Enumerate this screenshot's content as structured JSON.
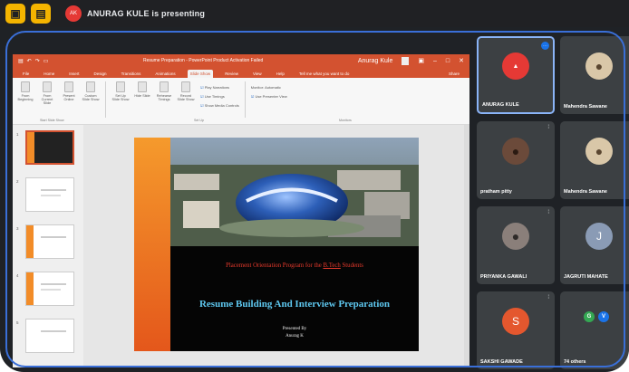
{
  "meet": {
    "presenting_text": "ANURAG KULE is presenting",
    "presenter_initial": "AK"
  },
  "powerpoint": {
    "window_title": "Resume Preparation - PowerPoint Product Activation Failed",
    "user": "Anurag Kule",
    "tabs": [
      "File",
      "Home",
      "Insert",
      "Design",
      "Transitions",
      "Animations",
      "Slide Show",
      "Review",
      "View",
      "Help",
      "Tell me what you want to do"
    ],
    "active_tab": "Slide Show",
    "share_label": "Share",
    "ribbon": {
      "buttons": [
        {
          "label": "From Beginning"
        },
        {
          "label": "From Current Slide"
        },
        {
          "label": "Present Online"
        },
        {
          "label": "Custom Slide Show"
        },
        {
          "label": "Set Up Slide Show"
        },
        {
          "label": "Hide Slide"
        },
        {
          "label": "Rehearse Timings"
        },
        {
          "label": "Record Slide Show"
        }
      ],
      "checks": [
        {
          "label": "Play Narrations",
          "on": true
        },
        {
          "label": "Use Timings",
          "on": true
        },
        {
          "label": "Show Media Controls",
          "on": true
        }
      ],
      "monitor_label": "Monitor: Automatic",
      "presenter_view_label": "Use Presenter View",
      "group_start": "Start Slide Show",
      "group_setup": "Set Up",
      "group_monitors": "Monitors"
    },
    "thumbnails": [
      "1",
      "2",
      "3",
      "4",
      "5"
    ],
    "slide": {
      "heading_prefix": "Placement Orientation Program for the ",
      "heading_link": "B.Tech",
      "heading_suffix": " Students",
      "title": "Resume Building And Interview Preparation",
      "presented_by": "Presented By",
      "presenter_name": "Anurag K"
    }
  },
  "participants": [
    {
      "name": "ANURAG KULE",
      "avatar": "logo",
      "color": "#e53935",
      "pinned": true
    },
    {
      "name": "Mahendra Sawane",
      "avatar": "photo",
      "color": "#d9c7a8"
    },
    {
      "name": "pratham pitty",
      "avatar": "photo",
      "color": "#6b4a3a"
    },
    {
      "name": "Mahendra Sawane",
      "avatar": "photo",
      "color": "#d9c7a8"
    },
    {
      "name": "PRIYANKA GAWALI",
      "avatar": "photo",
      "color": "#8a7f7a"
    },
    {
      "name": "JAGRUTI MAHATE",
      "avatar": "J",
      "color": "#8a9bb5"
    },
    {
      "name": "SAKSHI GAWADE",
      "avatar": "S",
      "color": "#e4572e"
    },
    {
      "name": "74 others",
      "avatar": "group",
      "color": "#3c4043"
    }
  ],
  "others_initials": [
    "G",
    "V"
  ],
  "colors": {
    "powerpoint_accent": "#d35230",
    "meet_background": "#202124",
    "tile_background": "#3c4043",
    "pin_border": "#8ab4f8",
    "slide_title": "#5ec8f0",
    "slide_heading": "#e83a2c"
  }
}
